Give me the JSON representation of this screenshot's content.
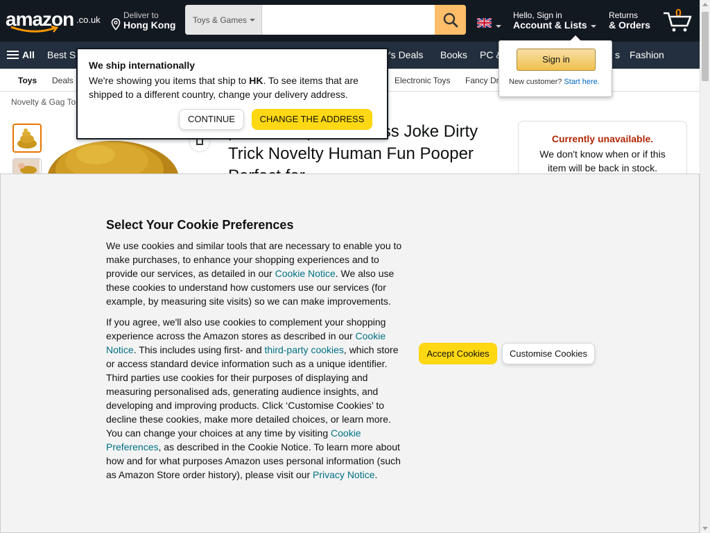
{
  "header": {
    "logo_text": "amazon",
    "logo_tld": ".co.uk",
    "deliver_line1": "Deliver to",
    "deliver_line2": "Hong Kong",
    "search_category": "Toys & Games",
    "search_value": "",
    "account_line1": "Hello, Sign in",
    "account_line2": "Account & Lists",
    "returns_line1": "Returns",
    "returns_line2": "& Orders",
    "cart_count": "0"
  },
  "nav_main": {
    "all_label": "All",
    "links": [
      "Best S",
      "y's Deals",
      "Books",
      "PC &",
      "s",
      "Fashion"
    ]
  },
  "nav_sub": {
    "items": [
      "Toys",
      "Deals",
      "Electronic Toys",
      "Fancy Dr"
    ]
  },
  "breadcrumb": "Novelty & Gag To",
  "product": {
    "title": "p Turd Crap Poo Gross Joke Dirty Trick Novelty Human Fun Pooper Perfect for"
  },
  "buybox": {
    "unavailable": "Currently unavailable.",
    "message": "We don't know when or if this item will be back in stock."
  },
  "ship_popover": {
    "heading": "We ship internationally",
    "body_before": "We're showing you items that ship to ",
    "body_country": "HK",
    "body_after": ". To see items that are shipped to a different country, change your delivery address.",
    "continue_label": "CONTINUE",
    "change_label": "CHANGE THE ADDRESS"
  },
  "signin_flyout": {
    "button_label": "Sign in",
    "new_customer": "New customer?",
    "start_here": "Start here."
  },
  "cookie": {
    "title": "Select Your Cookie Preferences",
    "p1_a": "We use cookies and similar tools that are necessary to enable you to make purchases, to enhance your shopping experiences and to provide our services, as detailed in our ",
    "p1_link": "Cookie Notice",
    "p1_b": ". We also use these cookies to understand how customers use our services (for example, by measuring site visits) so we can make improvements.",
    "p2_a": "If you agree, we'll also use cookies to complement your shopping experience across the Amazon stores as described in our ",
    "p2_link1": "Cookie Notice",
    "p2_b": ". This includes using first- and ",
    "p2_link2": "third-party cookies",
    "p2_c": ", which store or access standard device information such as a unique identifier. Third parties use cookies for their purposes of displaying and measuring personalised ads, generating audience insights, and developing and improving products. Click ‘Customise Cookies’ to decline these cookies, make more detailed choices, or learn more. You can change your choices at any time by visiting ",
    "p2_link3": "Cookie Preferences",
    "p2_d": ", as described in the Cookie Notice. To learn more about how and for what purposes Amazon uses personal information (such as Amazon Store order history), please visit our ",
    "p2_link4": "Privacy Notice",
    "p2_e": ".",
    "accept_label": "Accept Cookies",
    "customise_label": "Customise Cookies"
  },
  "colors": {
    "header_bg": "#131921",
    "nav_bg": "#232f3e",
    "accent_yellow": "#ffd814",
    "search_button": "#febd69",
    "link": "#007185",
    "unavailable": "#b12704"
  }
}
